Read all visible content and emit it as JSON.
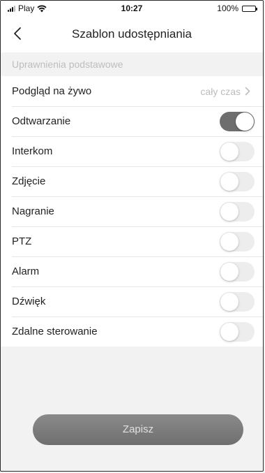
{
  "status_bar": {
    "carrier": "Play",
    "time": "10:27",
    "battery": "100%"
  },
  "nav": {
    "title": "Szablon udostępniania",
    "back_icon": "chevron-left-icon"
  },
  "section": {
    "header": "Uprawnienia podstawowe"
  },
  "live_view": {
    "label": "Podgląd na żywo",
    "value": "cały czas"
  },
  "permissions": [
    {
      "label": "Odtwarzanie",
      "enabled": true
    },
    {
      "label": "Interkom",
      "enabled": false
    },
    {
      "label": "Zdjęcie",
      "enabled": false
    },
    {
      "label": "Nagranie",
      "enabled": false
    },
    {
      "label": "PTZ",
      "enabled": false
    },
    {
      "label": "Alarm",
      "enabled": false
    },
    {
      "label": "Dźwięk",
      "enabled": false
    },
    {
      "label": "Zdalne sterowanie",
      "enabled": false
    }
  ],
  "save_label": "Zapisz",
  "colors": {
    "toggle_on": "#6e6e6e",
    "toggle_off": "#ededed",
    "muted_text": "#bdbdbd",
    "button": "#7c7c7c"
  }
}
